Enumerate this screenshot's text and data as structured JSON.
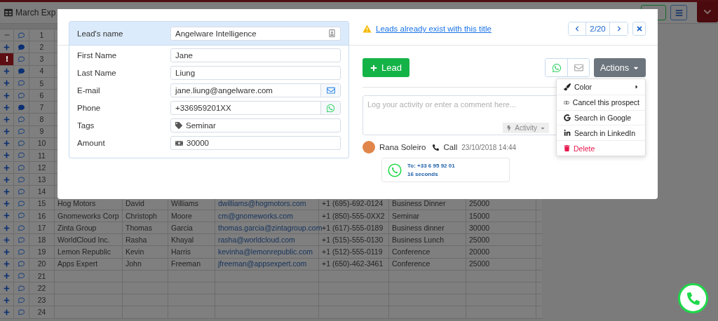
{
  "app": {
    "title": "March Exp"
  },
  "sheet": {
    "rows": [
      {
        "number": "1",
        "kind": "collapse",
        "has_comments": false,
        "cells": []
      },
      {
        "number": "2",
        "kind": "expand",
        "has_comments": true,
        "cells": []
      },
      {
        "number": "3",
        "kind": "alert",
        "has_comments": false,
        "cells": []
      },
      {
        "number": "4",
        "kind": "expand",
        "has_comments": true,
        "cells": []
      },
      {
        "number": "5",
        "kind": "expand",
        "has_comments": false,
        "cells": []
      },
      {
        "number": "6",
        "kind": "expand",
        "has_comments": false,
        "cells": []
      },
      {
        "number": "7",
        "kind": "expand",
        "has_comments": true,
        "cells": []
      },
      {
        "number": "8",
        "kind": "expand",
        "has_comments": false,
        "cells": []
      },
      {
        "number": "9",
        "kind": "expand",
        "has_comments": false,
        "cells": []
      },
      {
        "number": "10",
        "kind": "expand",
        "has_comments": false,
        "cells": []
      },
      {
        "number": "11",
        "kind": "expand",
        "has_comments": false,
        "cells": []
      },
      {
        "number": "12",
        "kind": "expand",
        "has_comments": false,
        "cells": []
      },
      {
        "number": "13",
        "kind": "expand",
        "has_comments": false,
        "cells": []
      },
      {
        "number": "14",
        "kind": "expand",
        "has_comments": false,
        "cells": []
      },
      {
        "number": "15",
        "kind": "expand",
        "has_comments": false,
        "cells": [
          "Hog Motors",
          "David",
          "Williams",
          "dwilliams@hogmotors.com",
          "+1 (695)-692-0124",
          "Business Dinner",
          "25000"
        ]
      },
      {
        "number": "16",
        "kind": "expand",
        "has_comments": false,
        "cells": [
          "Gnomeworks Corp",
          "Christoph",
          "Moore",
          "cm@gnomeworks.com",
          "+1 (850)-555-0XX2",
          "Seminar",
          "15000"
        ]
      },
      {
        "number": "17",
        "kind": "expand",
        "has_comments": false,
        "cells": [
          "Zinta Group",
          "Thomas",
          "Garcia",
          "thomas.garcia@zintagroup.com",
          "+1 (617)-555-0189",
          "Business dinner",
          "30000"
        ]
      },
      {
        "number": "18",
        "kind": "expand",
        "has_comments": false,
        "cells": [
          "WorldCloud Inc.",
          "Rasha",
          "Khayal",
          "rasha@worldcloud.com",
          "+1 (515)-555-0130",
          "Business Lunch",
          "25000"
        ]
      },
      {
        "number": "19",
        "kind": "expand",
        "has_comments": false,
        "cells": [
          "Lemon Republic",
          "Kevin",
          "Harris",
          "kevinha@lemonrepublic.com",
          "+1 (512)-555-0119",
          "Conference",
          "20000"
        ]
      },
      {
        "number": "20",
        "kind": "expand",
        "has_comments": false,
        "cells": [
          "Apps Expert",
          "John",
          "Freeman",
          "jfreeman@appsexpert.com",
          "+1 (650)-462-3461",
          "Conference",
          "25000"
        ]
      },
      {
        "number": "21",
        "kind": "expand",
        "has_comments": false,
        "cells": []
      },
      {
        "number": "22",
        "kind": "expand",
        "has_comments": false,
        "cells": []
      },
      {
        "number": "23",
        "kind": "expand",
        "has_comments": false,
        "cells": []
      },
      {
        "number": "24",
        "kind": "expand",
        "has_comments": false,
        "cells": []
      }
    ]
  },
  "modal": {
    "warning_link": "Leads already exist with this title",
    "pager": "2/20",
    "lead_name": {
      "label": "Lead's name",
      "value": "Angelware Intelligence"
    },
    "fields": [
      {
        "label": "First Name",
        "value": "Jane",
        "kind": "text"
      },
      {
        "label": "Last Name",
        "value": "Liung",
        "kind": "text"
      },
      {
        "label": "E-mail",
        "value": "jane.liung@angelware.com",
        "kind": "email"
      },
      {
        "label": "Phone",
        "value": "+336959201XX",
        "kind": "phone"
      },
      {
        "label": "Tags",
        "value": "Seminar",
        "kind": "tag"
      },
      {
        "label": "Amount",
        "value": "30000",
        "kind": "amount"
      }
    ],
    "add_lead_button": "Lead",
    "actions_button": "Actions",
    "actions_menu": [
      {
        "label": "Color",
        "kind": "color"
      },
      {
        "label": "Cancel this prospect",
        "kind": "cancel"
      },
      {
        "label": "Search in Google",
        "kind": "google"
      },
      {
        "label": "Search in LinkedIn",
        "kind": "linkedin"
      },
      {
        "label": "Delete",
        "kind": "delete"
      }
    ],
    "comment_box": {
      "placeholder": "Log your activity or enter a comment here...",
      "activity_button": "Activity"
    },
    "activities": [
      {
        "author": "Rana Soleiro",
        "type": "Call",
        "time": "23/10/2018 14:44",
        "to": "To: +33 6 95 92 01",
        "duration": "16 seconds"
      }
    ]
  }
}
